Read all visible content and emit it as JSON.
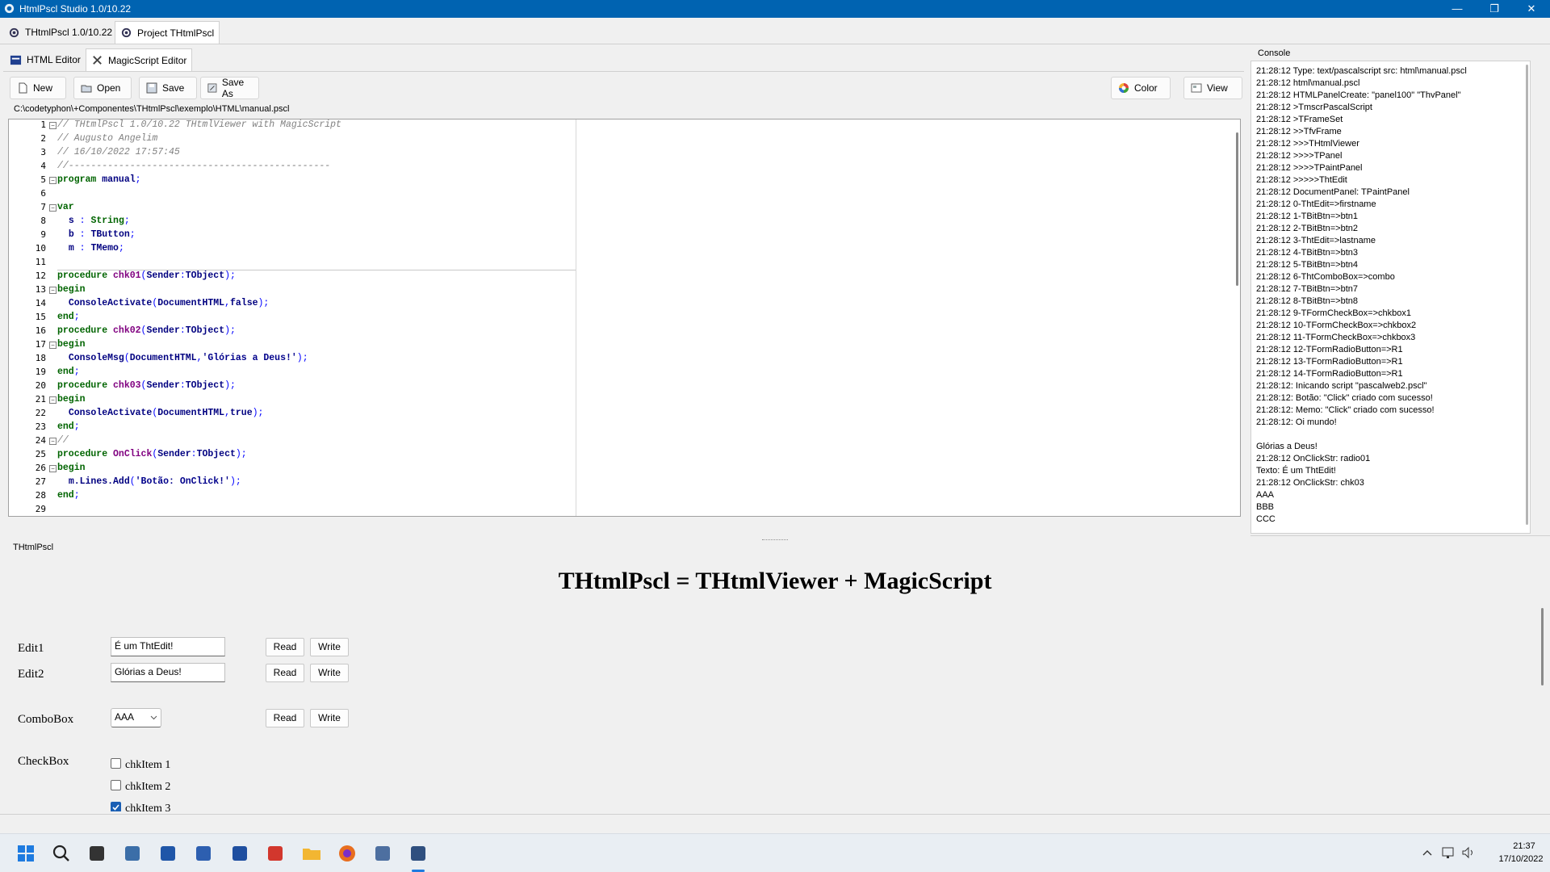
{
  "window": {
    "title": "HtmlPscl Studio 1.0/10.22",
    "controls": {
      "minimize": "—",
      "maximize": "❐",
      "close": "✕"
    }
  },
  "top_tabs": [
    {
      "label": "THtmlPscl 1.0/10.22",
      "icon": "gear-icon"
    },
    {
      "label": "Project THtmlPscl",
      "icon": "gear-icon",
      "active": true
    }
  ],
  "editor_tabs": [
    {
      "label": "HTML Editor",
      "icon": "html-icon"
    },
    {
      "label": "MagicScript Editor",
      "icon": "script-icon",
      "active": true
    }
  ],
  "toolbar": {
    "new_label": "New",
    "open_label": "Open",
    "save_label": "Save",
    "saveas_label": "Save As",
    "color_label": "Color",
    "view_label": "View"
  },
  "file_path": "C:\\codetyphon\\+Componentes\\THtmlPscl\\exemplo\\HTML\\manual.pscl",
  "code_lines": [
    "// THtmlPscl 1.0/10.22 THtmlViewer with MagicScript",
    "// Augusto Angelim",
    "// 16/10/2022 17:57:45",
    "//-----------------------------------------------",
    "program manual;",
    "",
    "var",
    "  s : String;",
    "  b : TButton;",
    "  m : TMemo;",
    "",
    "procedure chk01(Sender:TObject);",
    "begin",
    "  ConsoleActivate(DocumentHTML,false);",
    "end;",
    "procedure chk02(Sender:TObject);",
    "begin",
    "  ConsoleMsg(DocumentHTML,'Glórias a Deus!');",
    "end;",
    "procedure chk03(Sender:TObject);",
    "begin",
    "  ConsoleActivate(DocumentHTML,true);",
    "end;",
    "//",
    "procedure OnClick(Sender:TObject);",
    "begin",
    "  m.Lines.Add('Botão: OnClick!');",
    "end;",
    ""
  ],
  "line_numbers": [
    "1",
    "2",
    "3",
    "4",
    "5",
    "6",
    "7",
    "8",
    "9",
    "10",
    "11",
    "12",
    "13",
    "14",
    "15",
    "16",
    "17",
    "18",
    "19",
    "20",
    "21",
    "22",
    "23",
    "24",
    "25",
    "26",
    "27",
    "28",
    "29"
  ],
  "console": {
    "title": "Console",
    "lines": [
      "21:28:12 Type: text/pascalscript src: html\\manual.pscl",
      "21:28:12 html\\manual.pscl",
      "21:28:12 HTMLPanelCreate: \"panel100\" \"ThvPanel\"",
      "21:28:12 >TmscrPascalScript",
      "21:28:12 >TFrameSet",
      "21:28:12 >>TfvFrame",
      "21:28:12 >>>THtmlViewer",
      "21:28:12 >>>>TPanel",
      "21:28:12 >>>>TPaintPanel",
      "21:28:12 >>>>>ThtEdit",
      "21:28:12 DocumentPanel: TPaintPanel",
      "21:28:12 0-ThtEdit=>firstname",
      "21:28:12 1-TBitBtn=>btn1",
      "21:28:12 2-TBitBtn=>btn2",
      "21:28:12 3-ThtEdit=>lastname",
      "21:28:12 4-TBitBtn=>btn3",
      "21:28:12 5-TBitBtn=>btn4",
      "21:28:12 6-ThtComboBox=>combo",
      "21:28:12 7-TBitBtn=>btn7",
      "21:28:12 8-TBitBtn=>btn8",
      "21:28:12 9-TFormCheckBox=>chkbox1",
      "21:28:12 10-TFormCheckBox=>chkbox2",
      "21:28:12 11-TFormCheckBox=>chkbox3",
      "21:28:12 12-TFormRadioButton=>R1",
      "21:28:12 13-TFormRadioButton=>R1",
      "21:28:12 14-TFormRadioButton=>R1",
      "21:28:12: Inicando script \"pascalweb2.pscl\"",
      "21:28:12: Botão: \"Click\" criado com sucesso!",
      "21:28:12: Memo: \"Click\" criado com sucesso!",
      "21:28:12: Oi mundo!",
      "",
      "Glórias a Deus!",
      "21:28:12 OnClickStr: radio01",
      "Texto: É um ThtEdit!",
      "21:28:12 OnClickStr: chk03",
      "AAA",
      "BBB",
      "CCC"
    ]
  },
  "viewer": {
    "panel_label": "THtmlPscl",
    "heading": "THtmlPscl = THtmlViewer + MagicScript",
    "edit1_label": "Edit1",
    "edit1_value": "É um ThtEdit!",
    "edit2_label": "Edit2",
    "edit2_value": "Glórias a Deus!",
    "read_label": "Read",
    "write_label": "Write",
    "combo_label": "ComboBox",
    "combo_value": "AAA",
    "checkbox_label": "CheckBox",
    "check_items": [
      {
        "label": "chkItem 1",
        "checked": false
      },
      {
        "label": "chkItem 2",
        "checked": false
      },
      {
        "label": "chkItem 3",
        "checked": true
      }
    ]
  },
  "taskbar": {
    "time": "21:37",
    "date": "17/10/2022",
    "apps": [
      "start-icon",
      "search-icon",
      "task-view-icon",
      "monitor-app-icon",
      "notes-app-icon",
      "store-icon",
      "editor-app-icon",
      "sync-app-icon",
      "folder-icon",
      "firefox-icon",
      "typhon-icon",
      "htmlpscl-icon"
    ]
  },
  "colors": {
    "titlebar": "#0063b1",
    "keyword": "#006400",
    "comment": "#808080",
    "procname": "#800080",
    "checked": "#1a5fb4"
  }
}
